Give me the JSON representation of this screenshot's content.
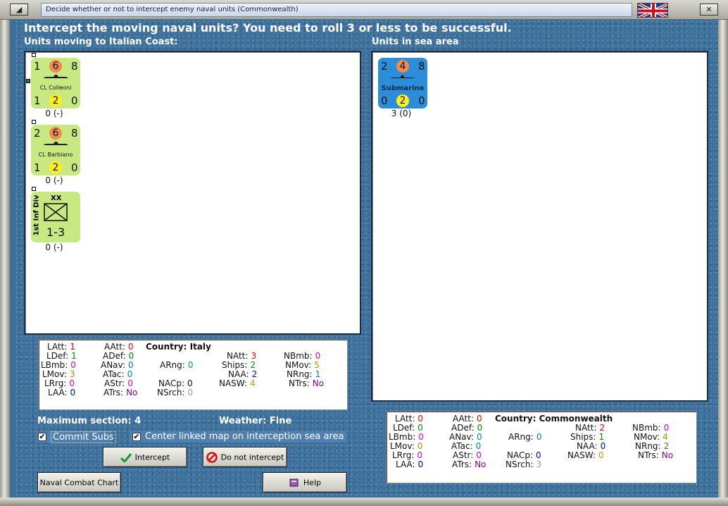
{
  "window": {
    "title": "Decide whether or not to intercept enemy naval units (Commonwealth)",
    "menu_icon": "window-menu-icon",
    "close_icon": "close-icon",
    "flag_icon": "union-jack-flag-icon"
  },
  "heading": "Intercept the moving naval units?  You need to roll 3 or less to be successful.",
  "left_panel_label": "Units moving to Italian Coast:",
  "right_panel_label": "Units in sea area",
  "moving_units": [
    {
      "type": "ship",
      "top_left": "1",
      "top_mid": "6",
      "top_right": "8",
      "name": "CL Colleoni",
      "bot_left": "1",
      "bot_mid": "2",
      "bot_right": "0",
      "under": "0 (-)"
    },
    {
      "type": "ship",
      "top_left": "2",
      "top_mid": "6",
      "top_right": "8",
      "name": "CL Barbiano",
      "bot_left": "1",
      "bot_mid": "2",
      "bot_right": "0",
      "under": "0 (-)"
    },
    {
      "type": "division",
      "side_label": "1st Inf Div",
      "size": "XX",
      "strength": "1-3",
      "under": "0 (-)"
    }
  ],
  "sea_units": [
    {
      "type": "sub",
      "top_left": "2",
      "top_mid": "4",
      "top_right": "8",
      "name": "Submarine",
      "bot_left": "0",
      "bot_mid": "2",
      "bot_right": "0",
      "under": "3 (0)"
    }
  ],
  "italy_stats": {
    "country_label": "Country:",
    "country": "Italy",
    "LAtt": "1",
    "LDef": "1",
    "LBmb": "0",
    "LMov": "3",
    "LRrg": "0",
    "LAA": "0",
    "AAtt": "0",
    "ADef": "0",
    "ANav": "0",
    "ATac": "0",
    "AStr": "0",
    "ATrs": "No",
    "ARng": "0",
    "NACp": "0",
    "NSrch": "0",
    "NAtt": "3",
    "Ships": "2",
    "NAA": "2",
    "NASW": "4",
    "NBmb": "0",
    "NMov": "5",
    "NRng": "1",
    "NTrs": "No"
  },
  "cw_stats": {
    "country_label": "Country:",
    "country": "Commonwealth",
    "LAtt": "0",
    "LDef": "0",
    "LBmb": "0",
    "LMov": "0",
    "LRrg": "0",
    "LAA": "0",
    "AAtt": "0",
    "ADef": "0",
    "ANav": "0",
    "ATac": "0",
    "AStr": "0",
    "ATrs": "No",
    "ARng": "0",
    "NACp": "0",
    "NSrch": "3",
    "NAtt": "2",
    "Ships": "1",
    "NAA": "0",
    "NASW": "0",
    "NBmb": "0",
    "NMov": "4",
    "NRng": "2",
    "NTrs": "No"
  },
  "max_section": "Maximum section: 4",
  "weather": "Weather:  Fine",
  "commit_subs": {
    "label": "Commit Subs",
    "checked": true
  },
  "center_map": {
    "label": "Center linked map on interception sea area",
    "checked": true
  },
  "buttons": {
    "intercept": "Intercept",
    "do_not_intercept": "Do not intercept",
    "naval_combat_chart": "Naval Combat Chart",
    "help": "Help"
  }
}
